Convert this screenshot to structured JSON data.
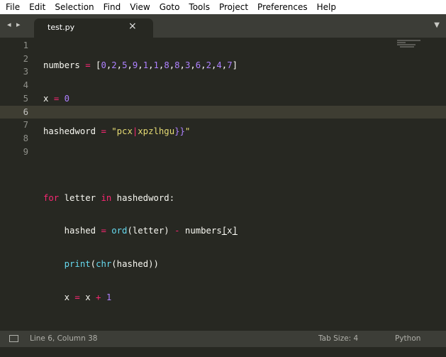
{
  "menubar": {
    "items": [
      "File",
      "Edit",
      "Selection",
      "Find",
      "View",
      "Goto",
      "Tools",
      "Project",
      "Preferences",
      "Help"
    ]
  },
  "tabbar": {
    "nav_icon": "◂ ▸",
    "tab_title": "test.py",
    "close_glyph": "×",
    "dropdown_glyph": "▼"
  },
  "editor": {
    "active_line": 6,
    "line_numbers": [
      "1",
      "2",
      "3",
      "4",
      "5",
      "6",
      "7",
      "8",
      "9"
    ]
  },
  "status": {
    "position": "Line 6, Column 38",
    "tab_size": "Tab Size: 4",
    "syntax": "Python"
  },
  "colors": {
    "background": "#272822",
    "keyword": "#f92672",
    "number": "#ae81ff",
    "string": "#e6db74",
    "builtin": "#66d9ef",
    "call": "#a6e22e",
    "text": "#f8f8f2"
  }
}
